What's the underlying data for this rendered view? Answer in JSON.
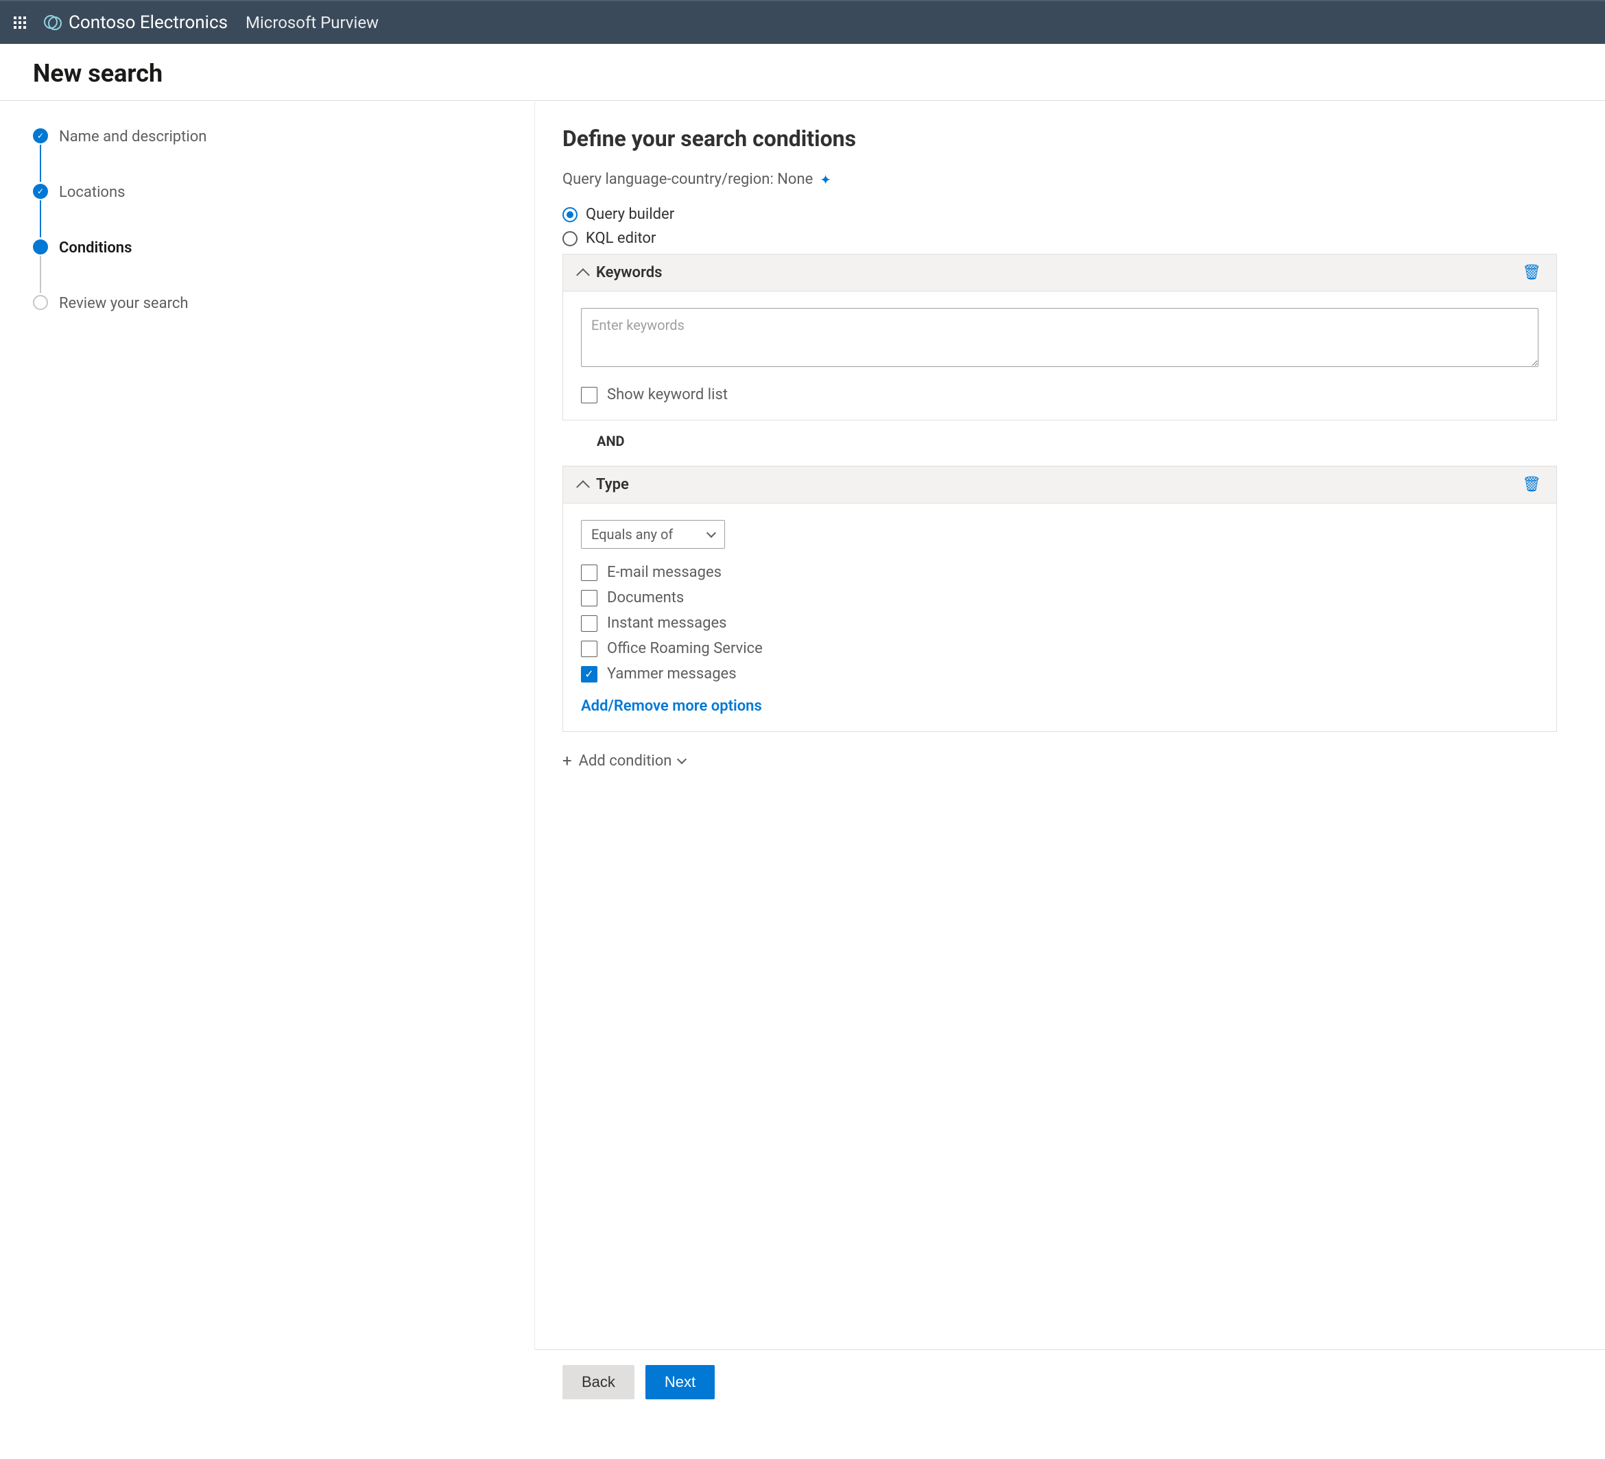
{
  "topbar": {
    "org_name": "Contoso Electronics",
    "product_name": "Microsoft Purview"
  },
  "page_title": "New search",
  "steps": [
    {
      "label": "Name and description",
      "state": "done"
    },
    {
      "label": "Locations",
      "state": "done"
    },
    {
      "label": "Conditions",
      "state": "current"
    },
    {
      "label": "Review your search",
      "state": "future"
    }
  ],
  "main": {
    "heading": "Define your search conditions",
    "query_lang_label": "Query language-country/region: None",
    "radio_builder": "Query builder",
    "radio_kql": "KQL editor",
    "keywords_card": {
      "title": "Keywords",
      "placeholder": "Enter keywords",
      "show_list_label": "Show keyword list"
    },
    "and_label": "AND",
    "type_card": {
      "title": "Type",
      "operator": "Equals any of",
      "options": [
        {
          "label": "E-mail messages",
          "checked": false
        },
        {
          "label": "Documents",
          "checked": false
        },
        {
          "label": "Instant messages",
          "checked": false
        },
        {
          "label": "Office Roaming Service",
          "checked": false
        },
        {
          "label": "Yammer messages",
          "checked": true
        }
      ],
      "more_link": "Add/Remove more options"
    },
    "add_condition": "Add condition"
  },
  "footer": {
    "back": "Back",
    "next": "Next"
  }
}
